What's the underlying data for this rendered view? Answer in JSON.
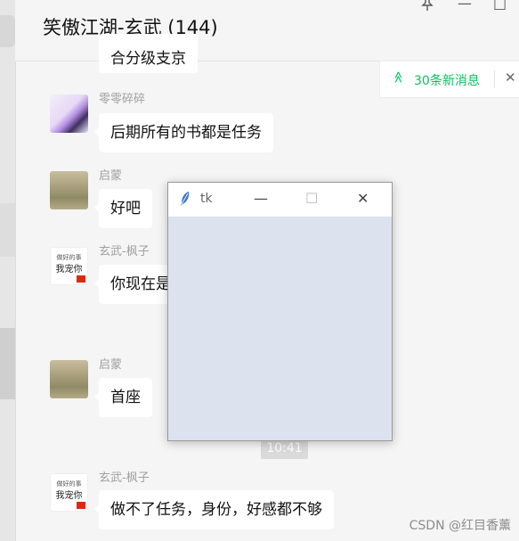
{
  "header": {
    "title": "笑傲江湖-玄武 (144)",
    "pin_icon": "pin-icon",
    "minimize_glyph": "—",
    "maximize_glyph": "□"
  },
  "new_messages_notice": {
    "text": "30条新消息",
    "up_glyph": "≫",
    "close_glyph": "✕",
    "color": "#07c160"
  },
  "messages": [
    {
      "name": "",
      "text": "合分级支京",
      "avatar": "text-avatar-partial"
    },
    {
      "name": "零零碎碎",
      "text": "后期所有的书都是任务",
      "avatar": "anime-avatar"
    },
    {
      "name": "启蒙",
      "text": "好吧",
      "avatar": "landscape-avatar"
    },
    {
      "name": "玄武-枫子",
      "text": "你现在是",
      "avatar": "text-flag-avatar"
    },
    {
      "name": "启蒙",
      "text": "首座",
      "avatar": "landscape-avatar"
    },
    {
      "name": "玄武-枫子",
      "text": "做不了任务，身份，好感都不够",
      "avatar": "text-flag-avatar"
    }
  ],
  "text_avatar": {
    "line1": "做好的事",
    "line2": "我宠你"
  },
  "timestamp": "10:41",
  "tk_window": {
    "title": "tk",
    "minimize_glyph": "—",
    "maximize_glyph": "☐",
    "close_glyph": "✕",
    "client_color": "#dde2ef"
  },
  "watermark": "CSDN @红目香薰"
}
